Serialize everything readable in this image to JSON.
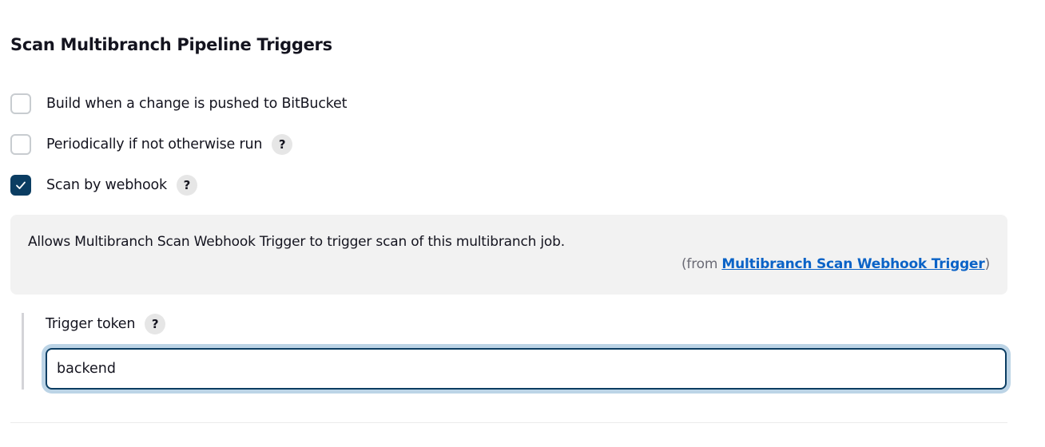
{
  "section": {
    "title": "Scan Multibranch Pipeline Triggers"
  },
  "triggers": [
    {
      "label": "Build when a change is pushed to BitBucket",
      "checked": false,
      "has_help": false
    },
    {
      "label": "Periodically if not otherwise run",
      "checked": false,
      "has_help": true,
      "help_label": "?"
    },
    {
      "label": "Scan by webhook",
      "checked": true,
      "has_help": true,
      "help_label": "?"
    }
  ],
  "help_panel": {
    "text": "Allows Multibranch Scan Webhook Trigger to trigger scan of this multibranch job.",
    "from_prefix": "(from ",
    "from_link": "Multibranch Scan Webhook Trigger",
    "from_suffix": ")"
  },
  "trigger_token": {
    "label": "Trigger token",
    "help_label": "?",
    "value": "backend"
  },
  "colors": {
    "checked_fill": "#0b3d62",
    "link": "#0b63c7",
    "focus_ring": "#bcd4e6"
  }
}
